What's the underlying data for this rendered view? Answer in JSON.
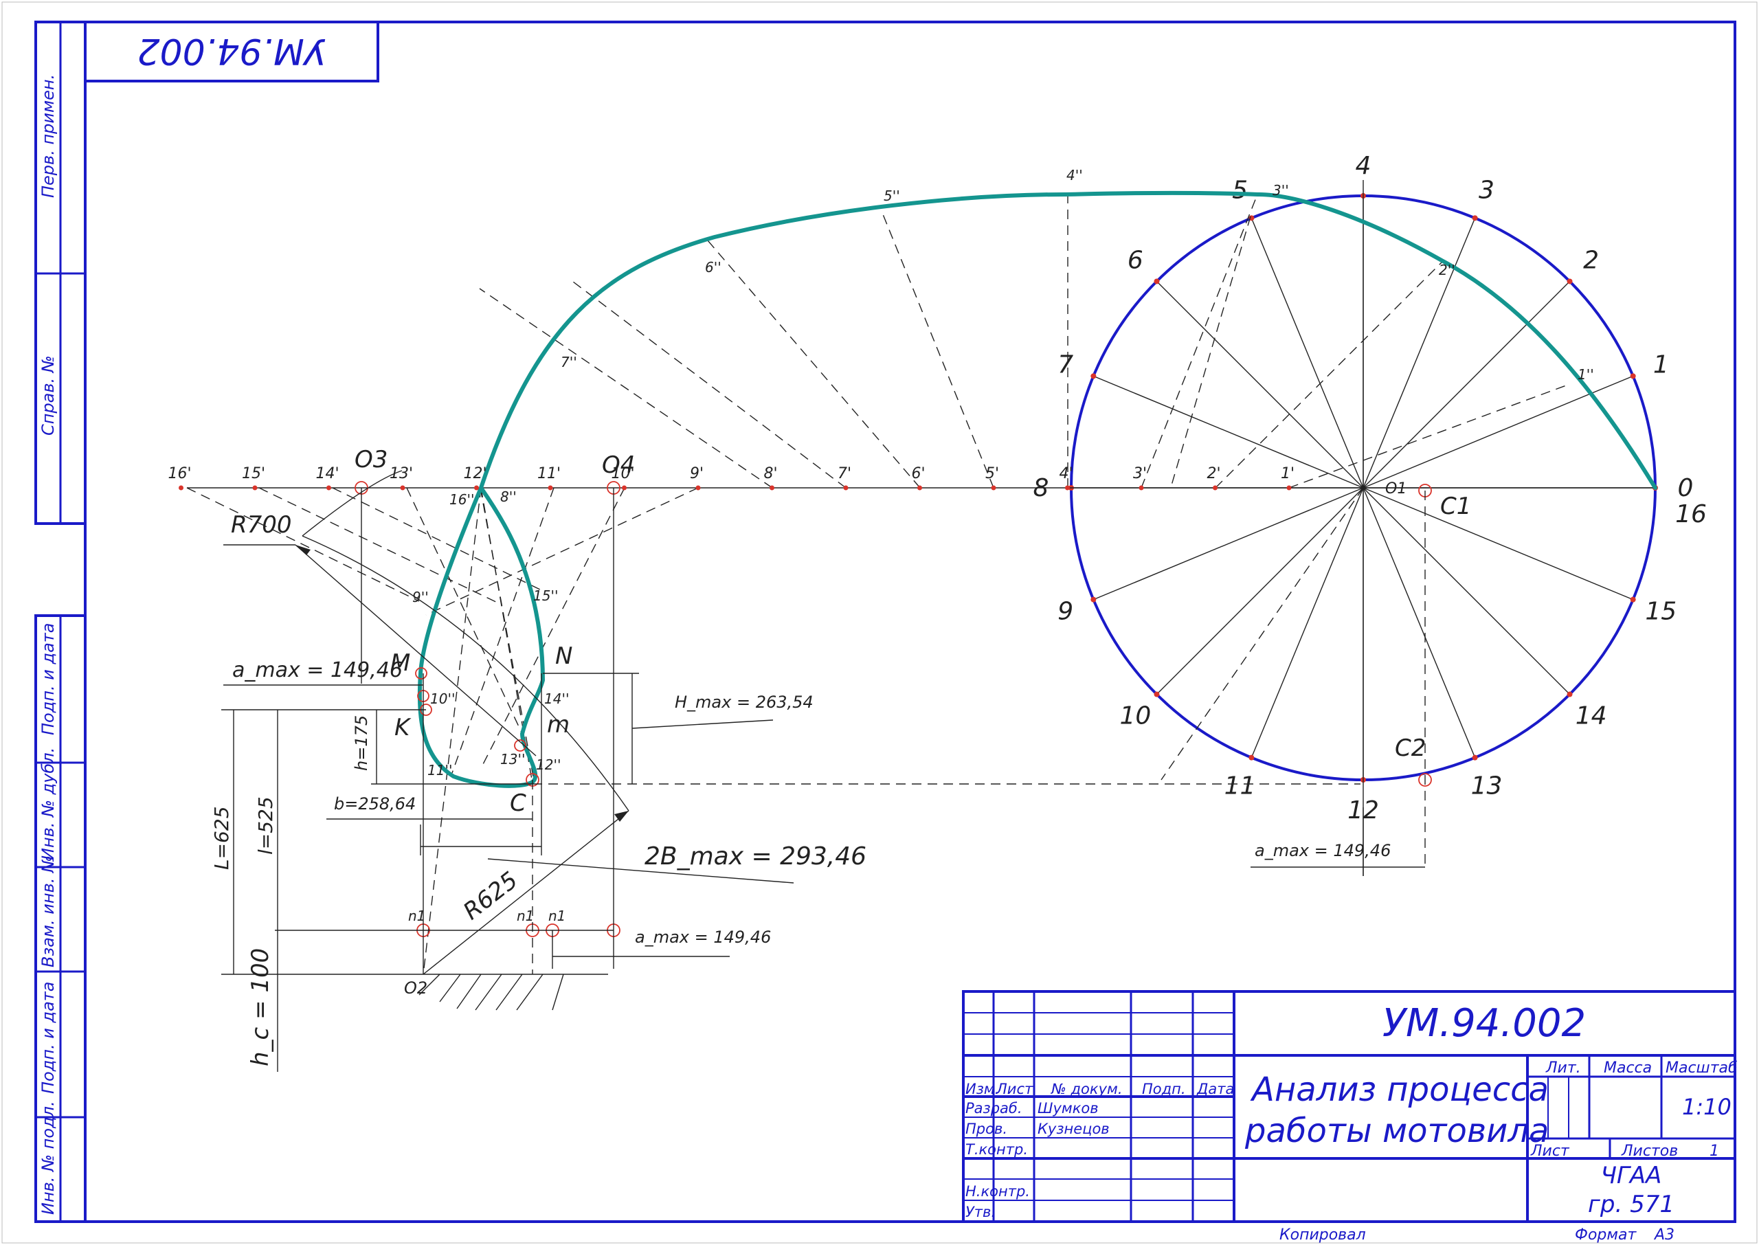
{
  "drawing": {
    "stamp_code_rotated": "УМ.94.002",
    "side_strip": {
      "perv_primen": "Перв. примен.",
      "sprav_no": "Справ. №",
      "podp_data_1": "Подп. и дата",
      "inv_dubl": "Инв. № дубл.",
      "vzam_inv": "Взам. инв. №",
      "podp_data_2": "Подп. и дата",
      "inv_podl": "Инв. № подл."
    },
    "title_block": {
      "code": "УМ.94.002",
      "title_line1": "Анализ процесса",
      "title_line2": "работы мотовила",
      "col_izm": "Изм.",
      "col_list": "Лист",
      "col_docum": "№ докум.",
      "col_podp": "Подп.",
      "col_data": "Дата",
      "row_razrab": "Разраб.",
      "row_prov": "Пров.",
      "row_tkontr": "Т.контр.",
      "row_nkontr": "Н.контр.",
      "row_utv": "Утв.",
      "razrab_name": "Шумков",
      "prov_name": "Кузнецов",
      "lit": "Лит.",
      "massa": "Масса",
      "masshtab": "Масштаб",
      "scale_value": "1:10",
      "sheet": "Лист",
      "sheets": "Листов",
      "sheets_value": "1",
      "org_line1": "ЧГАА",
      "org_line2": "гр. 571",
      "kopiroval": "Копировал",
      "format": "Формат",
      "format_value": "А3"
    },
    "circle_labels": [
      "0",
      "1",
      "2",
      "3",
      "4",
      "5",
      "6",
      "7",
      "8",
      "9",
      "10",
      "11",
      "12",
      "13",
      "14",
      "15",
      "16"
    ],
    "axis_prime_labels": [
      "1'",
      "2'",
      "3'",
      "4'",
      "5'",
      "6'",
      "7'",
      "8'",
      "9'",
      "10'",
      "11'",
      "12'",
      "13'",
      "14'",
      "15'",
      "16'"
    ],
    "traj_labels": [
      "1''",
      "2''",
      "3''",
      "4''",
      "5''",
      "6''",
      "7''",
      "8''",
      "9''",
      "10''",
      "11''",
      "12''",
      "13''",
      "14''",
      "15''",
      "16''"
    ],
    "points": {
      "O1": "O1",
      "O2": "O2",
      "O3": "O3",
      "O4": "O4",
      "C1": "C1",
      "C2": "C2",
      "C": "C",
      "M": "M",
      "N": "N",
      "K": "K",
      "m": "m",
      "n1": "n1"
    },
    "dimensions": {
      "r700": "R700",
      "r625": "R625",
      "amax_left": "a_max = 149,46",
      "amax_bottom": "a_max = 149,46",
      "amax_right": "a_max = 149,46",
      "hmax": "H_max = 263,54",
      "two_bmax": "2B_max = 293,46",
      "h175": "h=175",
      "b": "b=258,64",
      "L625": "L=625",
      "l525": "l=525",
      "hc100": "h_c = 100"
    },
    "colors": {
      "frame": "#1a1ac8",
      "trajectory": "#14958f",
      "points": "#d9342b",
      "lines": "#222222"
    }
  }
}
